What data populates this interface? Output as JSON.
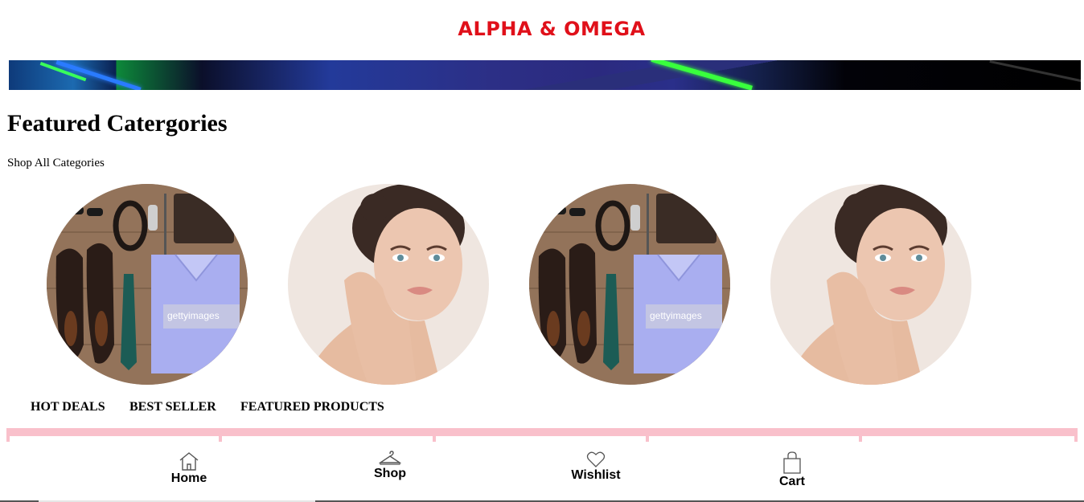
{
  "header": {
    "brand": "ALPHA & OMEGA"
  },
  "colors": {
    "brand": "#e0101a",
    "tab_strip": "#f9c0cb",
    "text": "#000000"
  },
  "featured": {
    "title": "Featured Catergories",
    "shop_all": "Shop All Categories",
    "categories": [
      {
        "image": "menswear-flatlay-photo",
        "watermark": "gettyimages"
      },
      {
        "image": "woman-portrait-photo"
      },
      {
        "image": "menswear-flatlay-photo",
        "watermark": "gettyimages"
      },
      {
        "image": "woman-portrait-photo"
      }
    ]
  },
  "product_tabs": [
    "HOT DEALS",
    "BEST SELLER",
    "FEATURED PRODUCTS"
  ],
  "bottom_nav": [
    {
      "label": "Home",
      "icon": "home-icon"
    },
    {
      "label": "Shop",
      "icon": "hanger-icon"
    },
    {
      "label": "Wishlist",
      "icon": "heart-icon"
    },
    {
      "label": "Cart",
      "icon": "shopping-bag-icon"
    }
  ]
}
